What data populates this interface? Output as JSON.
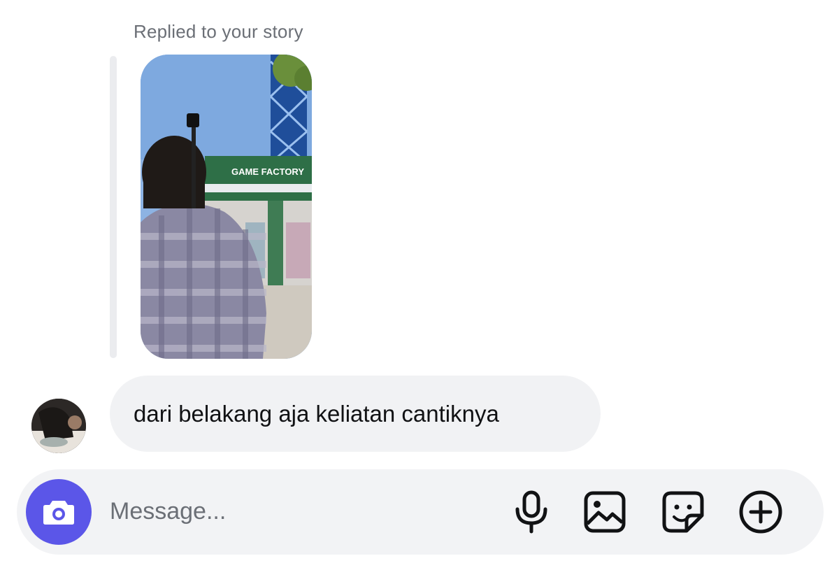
{
  "story_reply": {
    "label": "Replied to your story",
    "image_sign_text": "GAME FACTORY",
    "image_icon": "story-photo"
  },
  "message": {
    "text": "dari belakang aja keliatan cantiknya",
    "avatar_icon": "avatar-photo"
  },
  "composer": {
    "placeholder": "Message...",
    "camera_icon": "camera-icon",
    "mic_icon": "microphone-icon",
    "gallery_icon": "image-icon",
    "sticker_icon": "sticker-icon",
    "more_icon": "plus-circle-icon",
    "accent_color": "#5b56e8"
  }
}
